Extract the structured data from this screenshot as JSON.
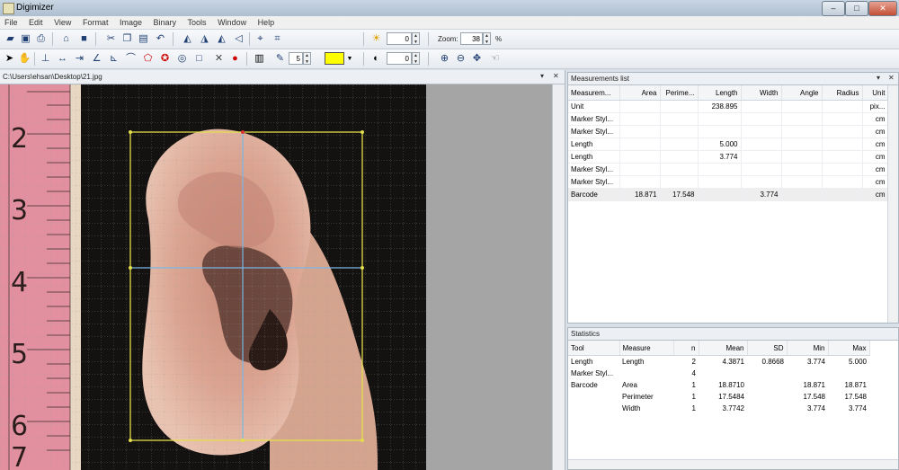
{
  "window": {
    "title": "Digimizer",
    "minimize": "–",
    "maximize": "□",
    "close": "✕"
  },
  "menu": [
    "File",
    "Edit",
    "View",
    "Format",
    "Image",
    "Binary",
    "Tools",
    "Window",
    "Help"
  ],
  "toolbar": {
    "brightness_value": "0",
    "contrast_value": "0",
    "zoom_label": "Zoom:",
    "zoom_value": "38",
    "zoom_unit": "%",
    "marker_size": "5",
    "marker_color": "#ffff00",
    "icons_row1": [
      "open-icon",
      "save-icon",
      "print-icon",
      "scan-icon",
      "camera-icon",
      "cut-icon",
      "copy-icon",
      "paste-icon",
      "undo-icon",
      "flip-horizontal-icon",
      "flip-vertical-icon",
      "rotate-left-icon",
      "rotate-right-icon",
      "crop-measure-icon",
      "crop-icon"
    ],
    "icons_row2": [
      "pointer-icon",
      "hand-select-icon",
      "marker-tool-icon",
      "line-tool-icon",
      "polyline-tool-icon",
      "angle-tool-icon",
      "angle-3pt-tool-icon",
      "multi-angle-tool-icon",
      "polygon-tool-icon",
      "freehand-tool-icon",
      "circle-tool-icon",
      "rectangle-tool-icon",
      "delete-marker-icon",
      "dot-marker-icon",
      "barcode-tool-icon",
      "pen-tool-icon"
    ]
  },
  "image_panel": {
    "path": "C:\\Users\\ehsan\\Desktop\\21.jpg"
  },
  "measurements": {
    "title": "Measurements list",
    "columns": [
      "Measurem...",
      "Area",
      "Perime...",
      "Length",
      "Width",
      "Angle",
      "Radius",
      "Unit"
    ],
    "rows": [
      [
        "Unit",
        "",
        "",
        "238.895",
        "",
        "",
        "",
        "pix..."
      ],
      [
        "Marker Styl...",
        "",
        "",
        "",
        "",
        "",
        "",
        "cm"
      ],
      [
        "Marker Styl...",
        "",
        "",
        "",
        "",
        "",
        "",
        "cm"
      ],
      [
        "Length",
        "",
        "",
        "5.000",
        "",
        "",
        "",
        "cm"
      ],
      [
        "Length",
        "",
        "",
        "3.774",
        "",
        "",
        "",
        "cm"
      ],
      [
        "Marker Styl...",
        "",
        "",
        "",
        "",
        "",
        "",
        "cm"
      ],
      [
        "Marker Styl...",
        "",
        "",
        "",
        "",
        "",
        "",
        "cm"
      ],
      [
        "Barcode",
        "18.871",
        "17.548",
        "",
        "3.774",
        "",
        "",
        "cm"
      ]
    ]
  },
  "statistics": {
    "title": "Statistics",
    "columns": [
      "Tool",
      "Measure",
      "n",
      "Mean",
      "SD",
      "Min",
      "Max"
    ],
    "rows": [
      [
        "Length",
        "Length",
        "2",
        "4.3871",
        "0.8668",
        "3.774",
        "5.000"
      ],
      [
        "Marker Styl...",
        "",
        "4",
        "",
        "",
        "",
        ""
      ],
      [
        "Barcode",
        "Area",
        "1",
        "18.8710",
        "",
        "18.871",
        "18.871"
      ],
      [
        "",
        "Perimeter",
        "1",
        "17.5484",
        "",
        "17.548",
        "17.548"
      ],
      [
        "",
        "Width",
        "1",
        "3.7742",
        "",
        "3.774",
        "3.774"
      ]
    ]
  },
  "ruler": {
    "numbers": [
      "2",
      "3",
      "4",
      "5",
      "6",
      "7"
    ]
  },
  "colors": {
    "ruler_pink": "#e2909f",
    "selection_yellow": "#e3de4c",
    "guide_blue": "#79b7e4",
    "skin": "#d89f8c"
  }
}
